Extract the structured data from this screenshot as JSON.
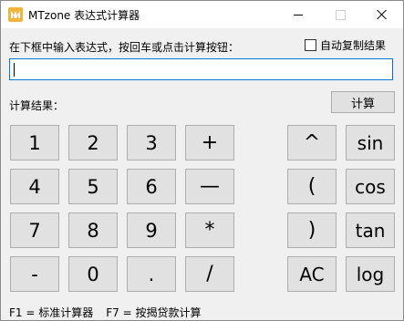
{
  "window": {
    "title": "MTzone 表达式计算器",
    "controls": {
      "minimize": "minimize",
      "maximize": "maximize",
      "close": "close"
    }
  },
  "input_section": {
    "prompt": "在下框中输入表达式，按回车或点击计算按钮：",
    "auto_copy_label": "自动复制结果",
    "auto_copy_checked": false,
    "expression_value": ""
  },
  "result_section": {
    "label": "计算结果：",
    "calc_button": "计算"
  },
  "keypad": {
    "digits": [
      "1",
      "2",
      "3",
      "4",
      "5",
      "6",
      "7",
      "8",
      "9",
      "0"
    ],
    "minus": "-",
    "dot": ".",
    "plus": "+",
    "long_minus": "—",
    "multiply": "*",
    "divide": "/",
    "power": "^",
    "lparen": "(",
    "rparen": ")",
    "ac": "AC",
    "sin": "sin",
    "cos": "cos",
    "tan": "tan",
    "log": "log"
  },
  "footer": {
    "f1": "F1 = 标准计算器",
    "f7": "F7 = 按揭贷款计算"
  }
}
